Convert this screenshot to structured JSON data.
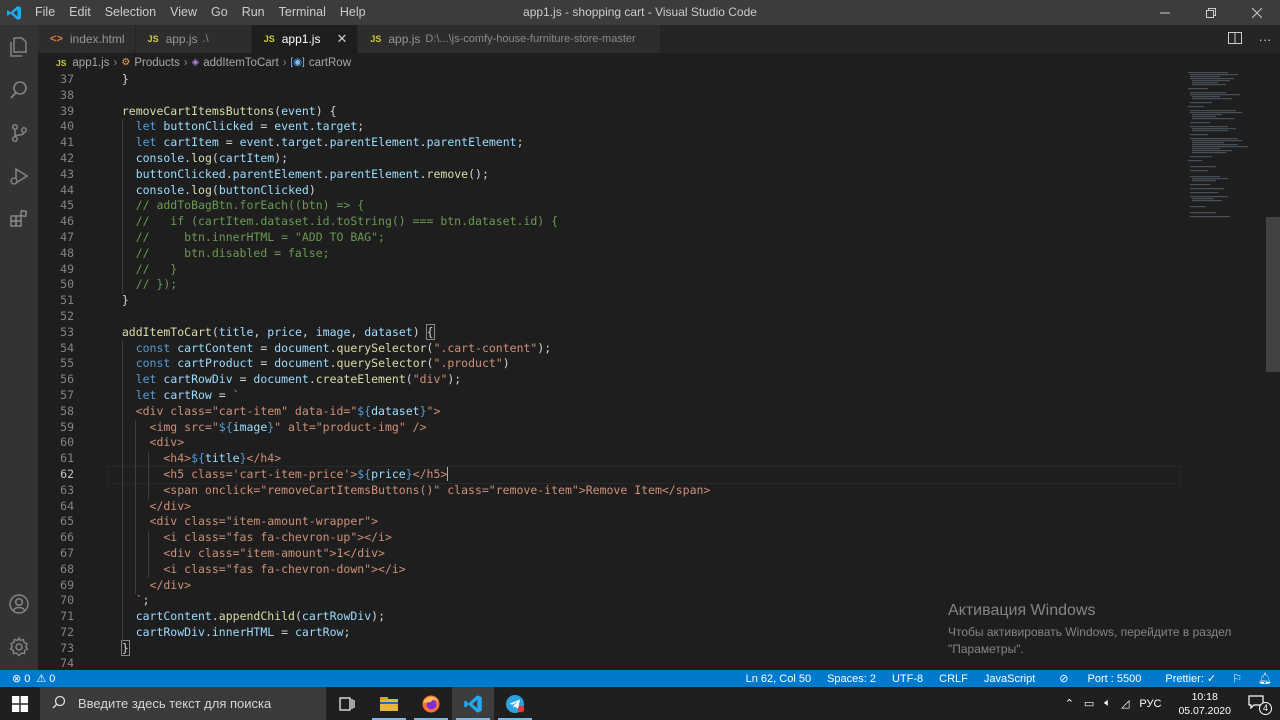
{
  "titlebar": {
    "menu": [
      "File",
      "Edit",
      "Selection",
      "View",
      "Go",
      "Run",
      "Terminal",
      "Help"
    ],
    "title": "app1.js - shopping cart - Visual Studio Code"
  },
  "tabs": [
    {
      "icon": "<>",
      "label": "index.html",
      "desc": ""
    },
    {
      "icon": "JS",
      "label": "app.js",
      "desc": ".\\"
    },
    {
      "icon": "JS",
      "label": "app1.js",
      "desc": ""
    },
    {
      "icon": "JS",
      "label": "app.js",
      "desc": "D:\\...\\js-comfy-house-furniture-store-master"
    }
  ],
  "breadcrumb": {
    "file_icon": "JS",
    "file": "app1.js",
    "class": "Products",
    "method": "addItemToCart",
    "variable": "cartRow"
  },
  "editor": {
    "line_numbers": [
      "37",
      "38",
      "39",
      "40",
      "41",
      "42",
      "43",
      "44",
      "45",
      "46",
      "47",
      "48",
      "49",
      "50",
      "51",
      "52",
      "53",
      "54",
      "55",
      "56",
      "57",
      "58",
      "59",
      "60",
      "61",
      "62",
      "63",
      "64",
      "65",
      "66",
      "67",
      "68",
      "69",
      "70",
      "71",
      "72",
      "73",
      "74"
    ],
    "current_line": "62"
  },
  "activation": {
    "title": "Активация Windows",
    "line1": "Чтобы активировать Windows, перейдите в раздел",
    "line2": "\"Параметры\"."
  },
  "statusbar": {
    "errors": "0",
    "warnings": "0",
    "position": "Ln 62, Col 50",
    "spaces": "Spaces: 2",
    "encoding": "UTF-8",
    "eol": "CRLF",
    "language": "JavaScript",
    "port": "Port : 5500",
    "prettier": "Prettier: ✓"
  },
  "taskbar": {
    "search_placeholder": "Введите здесь текст для поиска",
    "lang": "РУС",
    "time": "10:18",
    "date": "05.07.2020",
    "notification_count": "4"
  },
  "colors": {
    "statusbar": "#007acc",
    "titlebar": "#3c3c3c",
    "activitybar": "#333333",
    "editor": "#1e1e1e"
  }
}
